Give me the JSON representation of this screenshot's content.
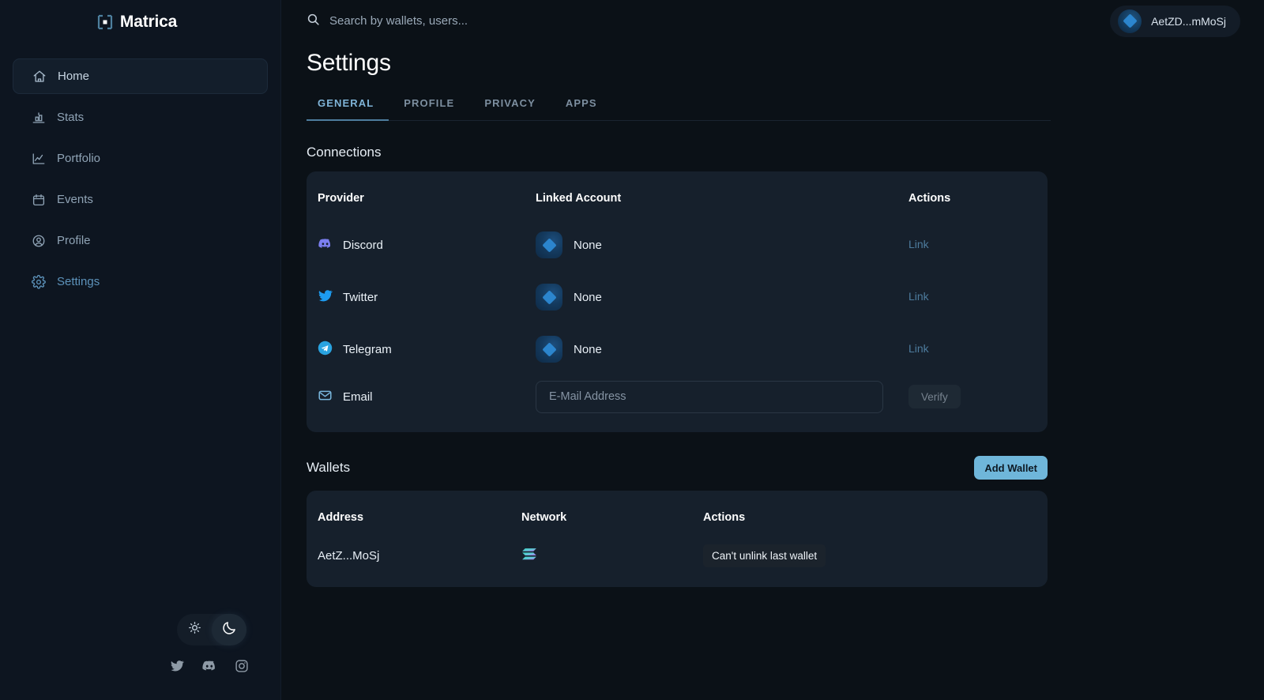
{
  "brand": {
    "name": "Matrica",
    "logo_icon": "matrica-bracket-logo"
  },
  "sidebar": {
    "items": [
      {
        "label": "Home",
        "icon": "home-icon",
        "state": "active"
      },
      {
        "label": "Stats",
        "icon": "stats-icon",
        "state": "default"
      },
      {
        "label": "Portfolio",
        "icon": "chart-line-icon",
        "state": "default"
      },
      {
        "label": "Events",
        "icon": "calendar-icon",
        "state": "default"
      },
      {
        "label": "Profile",
        "icon": "user-circle-icon",
        "state": "default"
      },
      {
        "label": "Settings",
        "icon": "gear-icon",
        "state": "current"
      }
    ],
    "theme_toggle": {
      "light_icon": "sun-icon",
      "dark_icon": "moon-icon",
      "selected": "dark"
    },
    "socials": [
      {
        "name": "twitter-icon"
      },
      {
        "name": "discord-icon"
      },
      {
        "name": "instagram-icon"
      }
    ]
  },
  "topbar": {
    "search": {
      "placeholder": "Search by wallets, users...",
      "value": "",
      "icon": "search-icon"
    },
    "account": {
      "label": "AetZD...mMoSj",
      "avatar_icon": "wallet-avatar-diamond"
    }
  },
  "page": {
    "title": "Settings",
    "tabs": [
      {
        "label": "GENERAL",
        "active": true
      },
      {
        "label": "PROFILE",
        "active": false
      },
      {
        "label": "PRIVACY",
        "active": false
      },
      {
        "label": "APPS",
        "active": false
      }
    ]
  },
  "connections": {
    "title": "Connections",
    "headers": {
      "provider": "Provider",
      "linked_account": "Linked Account",
      "actions": "Actions"
    },
    "rows": [
      {
        "provider": "Discord",
        "icon": "discord-icon",
        "linked_account": "None",
        "action": "Link"
      },
      {
        "provider": "Twitter",
        "icon": "twitter-icon",
        "linked_account": "None",
        "action": "Link"
      },
      {
        "provider": "Telegram",
        "icon": "telegram-icon",
        "linked_account": "None",
        "action": "Link"
      }
    ],
    "email_row": {
      "provider": "Email",
      "icon": "mail-icon",
      "input_placeholder": "E-Mail Address",
      "input_value": "",
      "action": "Verify"
    }
  },
  "wallets": {
    "title": "Wallets",
    "add_button": "Add Wallet",
    "headers": {
      "address": "Address",
      "network": "Network",
      "actions": "Actions"
    },
    "rows": [
      {
        "address": "AetZ...MoSj",
        "network_icon": "solana-icon",
        "action_note": "Can't unlink last wallet"
      }
    ]
  },
  "colors": {
    "app_background": "#0b1117",
    "sidebar_background": "#0d1520",
    "card_background": "#16202c",
    "accent_blue": "#6fb6da",
    "tab_active": "#7fb4d8",
    "link_action": "#4d7b9d",
    "text_primary": "#ffffff",
    "text_muted": "#8fa3b5"
  }
}
